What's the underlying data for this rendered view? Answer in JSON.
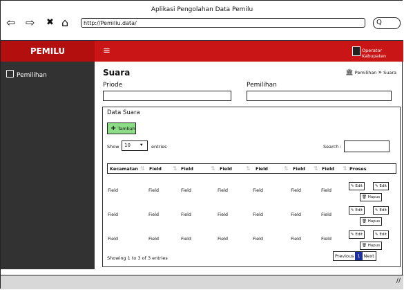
{
  "window": {
    "title": "Aplikasi Pengolahan Data Pemilu"
  },
  "browser": {
    "url": "http://Pemiliu.data/",
    "back_icon": "⇦",
    "forward_icon": "⇨",
    "close_icon": "✖",
    "home_icon": "⌂",
    "search_icon": "Q"
  },
  "topbar": {
    "brand": "PEMILU",
    "menu_icon": "≡",
    "user_label": "Operator Kabupaten"
  },
  "sidebar": {
    "items": [
      {
        "label": "Pemilihan"
      }
    ]
  },
  "page": {
    "title": "Suara",
    "breadcrumb": {
      "item1": "Pemilihan",
      "sep": "»",
      "item2": "Suara"
    }
  },
  "form": {
    "periode_label": "Priode",
    "pemilihan_label": "Pemilihan"
  },
  "panel": {
    "title": "Data Suara",
    "add_button": "Tambah",
    "show_label": "Show",
    "page_size": "10",
    "entries_label": "entries",
    "search_label": "Search :"
  },
  "table": {
    "headers": [
      "Kecamatan",
      "Field",
      "Field",
      "Field",
      "Field",
      "Field",
      "Field",
      "Proses"
    ],
    "rows": [
      [
        "Field",
        "Field",
        "Field",
        "Field",
        "Field",
        "Field",
        "Field"
      ],
      [
        "Field",
        "Field",
        "Field",
        "Field",
        "Field",
        "Field",
        "Field"
      ],
      [
        "Field",
        "Field",
        "Field",
        "Field",
        "Field",
        "Field",
        "Field"
      ]
    ],
    "actions": {
      "edit": "Edit",
      "delete": "Hapus"
    }
  },
  "footer": {
    "showing": "Showing 1 to 3 of 3 entries",
    "prev": "Previous",
    "page": "1",
    "next": "Next"
  },
  "colors": {
    "topbar": "#c91515",
    "sidebar": "#323232",
    "add_button": "#8ddc87",
    "pager_active": "#1e2fa0"
  }
}
